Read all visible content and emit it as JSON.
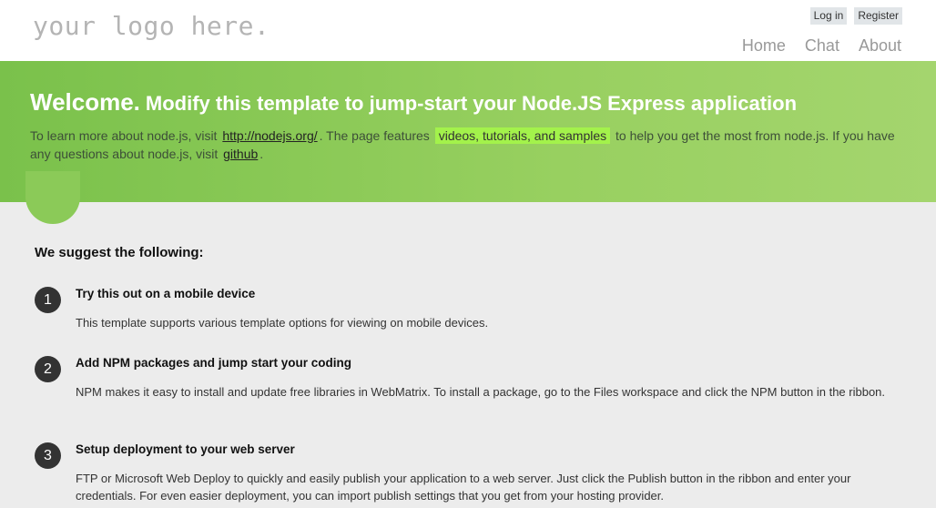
{
  "header": {
    "logo": "your logo here.",
    "auth": {
      "login": "Log in",
      "register": "Register"
    },
    "nav": [
      "Home",
      "Chat",
      "About"
    ]
  },
  "featured": {
    "title_strong": "Welcome.",
    "title_rest": "Modify this template to jump-start your Node.JS Express application",
    "intro_1": "To learn more about node.js, visit",
    "link_nodejs": "http://nodejs.org/",
    "intro_2": ". The page features",
    "highlight": "videos, tutorials, and samples",
    "intro_3": "to help you get the most from node.js. If you have any questions about node.js, visit",
    "link_github": "github",
    "intro_4": "."
  },
  "main": {
    "suggest_title": "We suggest the following:",
    "steps": [
      {
        "num": "1",
        "title": "Try this out on a mobile device",
        "desc": "This template supports various template options for viewing on mobile devices."
      },
      {
        "num": "2",
        "title": "Add NPM packages and jump start your coding",
        "desc": "NPM makes it easy to install and update free libraries in WebMatrix. To install a package, go to the Files workspace and click the NPM button in the ribbon."
      },
      {
        "num": "3",
        "title": "Setup deployment to your web server",
        "desc": "FTP or Microsoft Web Deploy to quickly and easily publish your application to a web server. Just click the Publish button in the ribbon and enter your credentials. For even easier deployment, you can import publish settings that you get from your hosting provider."
      }
    ]
  },
  "colors": {
    "band_left": "#7ac14b",
    "band_right": "#a4d56e",
    "highlight": "#a3f24b",
    "content_bg": "#ececec"
  }
}
